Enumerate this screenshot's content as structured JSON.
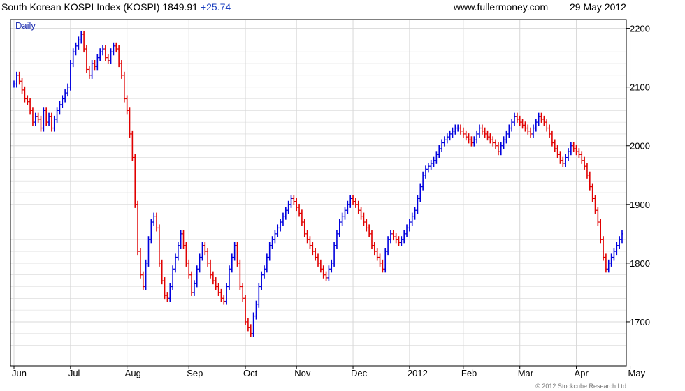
{
  "header": {
    "title": "South Korean KOSPI Index (KOSPI) 1849.91",
    "change": "+25.74",
    "site": "www.fullermoney.com",
    "date": "29 May 2012"
  },
  "copyright": "© 2012 Stockcube Research Ltd",
  "colors": {
    "up": "#0000dd",
    "down": "#e00000",
    "grid": "#d8d8d8",
    "frame": "#000000"
  },
  "chart_data": {
    "type": "ohlc",
    "period": "Daily",
    "title": "South Korean KOSPI Index (KOSPI)",
    "ylim": [
      1625,
      2215
    ],
    "y_ticks": [
      1700,
      1800,
      1900,
      2000,
      2100,
      2200
    ],
    "x_ticks": [
      {
        "label": "Jun",
        "i": 0
      },
      {
        "label": "Jul",
        "i": 21
      },
      {
        "label": "Aug",
        "i": 42
      },
      {
        "label": "Sep",
        "i": 65
      },
      {
        "label": "Oct",
        "i": 86
      },
      {
        "label": "Nov",
        "i": 105
      },
      {
        "label": "Dec",
        "i": 126
      },
      {
        "label": "2012",
        "i": 147
      },
      {
        "label": "Feb",
        "i": 167
      },
      {
        "label": "Mar",
        "i": 188
      },
      {
        "label": "Apr",
        "i": 209
      },
      {
        "label": "May",
        "i": 229
      }
    ],
    "grid": true,
    "legend": "none",
    "closes": [
      2105,
      2120,
      2110,
      2095,
      2080,
      2075,
      2060,
      2040,
      2050,
      2045,
      2030,
      2060,
      2040,
      2050,
      2030,
      2045,
      2060,
      2070,
      2080,
      2090,
      2100,
      2140,
      2160,
      2170,
      2180,
      2190,
      2165,
      2130,
      2120,
      2140,
      2135,
      2150,
      2160,
      2165,
      2150,
      2145,
      2160,
      2170,
      2165,
      2140,
      2120,
      2080,
      2060,
      2020,
      1980,
      1900,
      1820,
      1780,
      1760,
      1800,
      1840,
      1870,
      1880,
      1860,
      1800,
      1770,
      1745,
      1740,
      1760,
      1790,
      1810,
      1830,
      1850,
      1830,
      1800,
      1780,
      1750,
      1765,
      1790,
      1810,
      1830,
      1820,
      1800,
      1780,
      1770,
      1760,
      1750,
      1740,
      1735,
      1760,
      1790,
      1810,
      1830,
      1800,
      1760,
      1740,
      1700,
      1690,
      1680,
      1710,
      1730,
      1760,
      1780,
      1790,
      1810,
      1830,
      1840,
      1850,
      1860,
      1870,
      1880,
      1890,
      1900,
      1910,
      1905,
      1895,
      1885,
      1870,
      1850,
      1840,
      1830,
      1820,
      1810,
      1800,
      1790,
      1780,
      1775,
      1790,
      1800,
      1830,
      1850,
      1870,
      1880,
      1890,
      1900,
      1910,
      1905,
      1900,
      1890,
      1880,
      1870,
      1860,
      1850,
      1830,
      1820,
      1810,
      1800,
      1790,
      1820,
      1840,
      1850,
      1845,
      1840,
      1835,
      1840,
      1850,
      1860,
      1870,
      1880,
      1890,
      1910,
      1930,
      1950,
      1960,
      1965,
      1970,
      1975,
      1985,
      1995,
      2005,
      2010,
      2015,
      2020,
      2025,
      2030,
      2030,
      2025,
      2020,
      2015,
      2010,
      2005,
      2010,
      2020,
      2030,
      2025,
      2020,
      2015,
      2010,
      2005,
      2000,
      1990,
      2000,
      2010,
      2020,
      2030,
      2040,
      2050,
      2045,
      2040,
      2035,
      2030,
      2025,
      2020,
      2030,
      2040,
      2050,
      2045,
      2040,
      2030,
      2020,
      2005,
      1995,
      1985,
      1975,
      1970,
      1980,
      1990,
      2000,
      1995,
      1990,
      1985,
      1975,
      1965,
      1950,
      1930,
      1910,
      1890,
      1870,
      1840,
      1810,
      1790,
      1800,
      1810,
      1820,
      1830,
      1840,
      1850
    ]
  }
}
